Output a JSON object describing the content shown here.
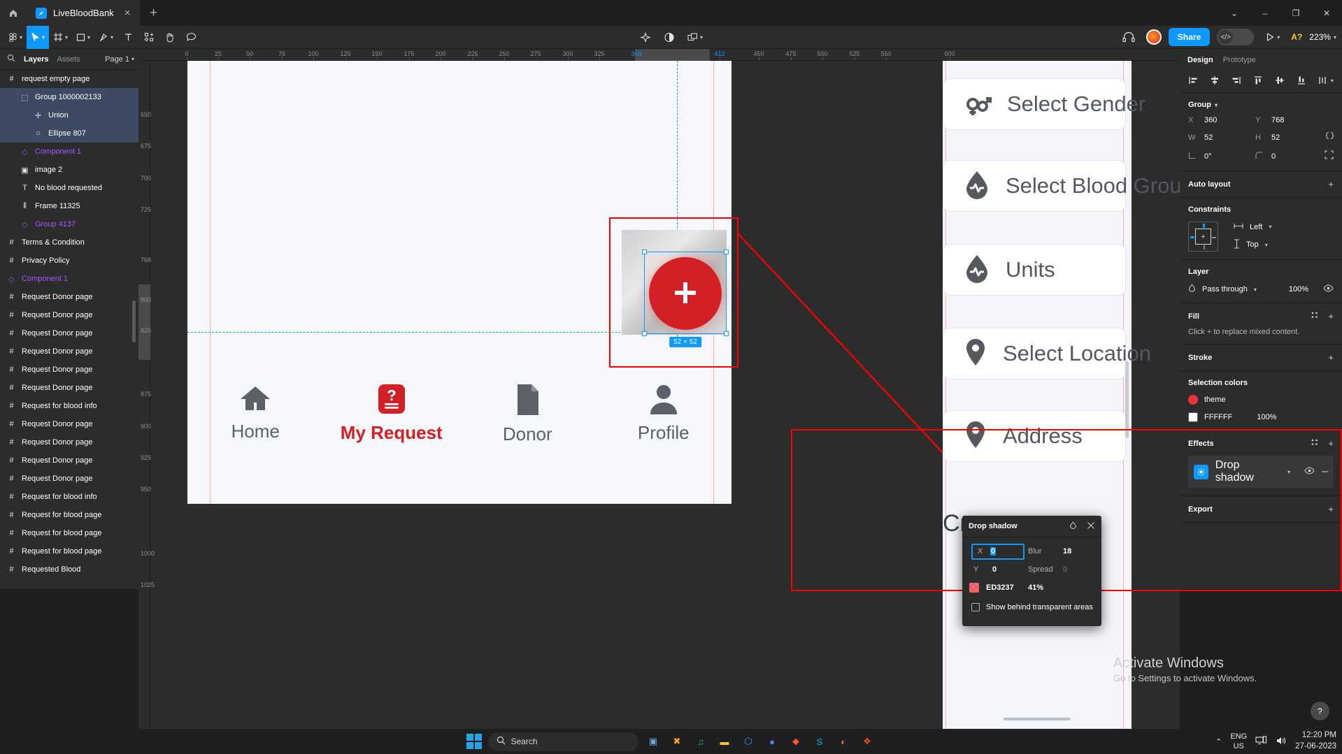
{
  "titlebar": {
    "home_icon": "home-icon",
    "tab": {
      "title": "LiveBloodBank",
      "close": "×",
      "icon": "figma-file-icon"
    },
    "new_tab": "+",
    "window": {
      "minimize": "–",
      "maximize": "❐",
      "close": "✕",
      "chevron": "⌄"
    }
  },
  "toolbar": {
    "menu_icon": "figma-logo-icon",
    "move_icon": "cursor-move-icon",
    "frame_icon": "frame-icon",
    "shape_icon": "rectangle-icon",
    "pen_icon": "pen-icon",
    "text_icon": "text-tool-icon",
    "component_icon": "component-icon",
    "hand_icon": "hand-tool-icon",
    "comment_icon": "comment-icon",
    "actions_icon": "actions-sparkle-icon",
    "contrast_icon": "contrast-icon",
    "boolean_icon": "boolean-union-icon",
    "headphones_icon": "headphones-icon",
    "avatar": "user-avatar",
    "share_label": "Share",
    "devmode_icon": "code-brackets-icon",
    "present_icon": "play-present-icon",
    "assistant_label": "A?",
    "zoom_label": "223%"
  },
  "layers_panel": {
    "search_icon": "search-icon",
    "tabs": [
      {
        "label": "Layers",
        "active": true
      },
      {
        "label": "Assets",
        "active": false
      }
    ],
    "page_selector": "Page 1",
    "items": [
      {
        "label": "request empty page",
        "icon": "frame-icon",
        "indent": 0,
        "selected": false,
        "component": false
      },
      {
        "label": "Group 1000002133",
        "icon": "group-icon",
        "indent": 1,
        "selected": true,
        "component": false
      },
      {
        "label": "Union",
        "icon": "union-icon",
        "indent": 2,
        "selected": true,
        "component": false
      },
      {
        "label": "Ellipse 807",
        "icon": "ellipse-icon",
        "indent": 2,
        "selected": true,
        "component": false
      },
      {
        "label": "Component 1",
        "icon": "component-icon",
        "indent": 1,
        "selected": false,
        "component": true
      },
      {
        "label": "image 2",
        "icon": "image-icon",
        "indent": 1,
        "selected": false,
        "component": false
      },
      {
        "label": "No blood requested",
        "icon": "text-icon",
        "indent": 1,
        "selected": false,
        "component": false
      },
      {
        "label": "Frame 11325",
        "icon": "autolayout-icon",
        "indent": 1,
        "selected": false,
        "component": false
      },
      {
        "label": "Group 4137",
        "icon": "component-icon",
        "indent": 1,
        "selected": false,
        "component": true
      },
      {
        "label": "Terms & Condition",
        "icon": "frame-icon",
        "indent": 0,
        "selected": false,
        "component": false
      },
      {
        "label": "Privacy Policy",
        "icon": "frame-icon",
        "indent": 0,
        "selected": false,
        "component": false
      },
      {
        "label": "Component 1",
        "icon": "component-icon",
        "indent": 0,
        "selected": false,
        "component": true
      },
      {
        "label": "Request Donor page",
        "icon": "frame-icon",
        "indent": 0,
        "selected": false,
        "component": false
      },
      {
        "label": "Request Donor page",
        "icon": "frame-icon",
        "indent": 0,
        "selected": false,
        "component": false
      },
      {
        "label": "Request Donor page",
        "icon": "frame-icon",
        "indent": 0,
        "selected": false,
        "component": false
      },
      {
        "label": "Request Donor page",
        "icon": "frame-icon",
        "indent": 0,
        "selected": false,
        "component": false
      },
      {
        "label": "Request Donor page",
        "icon": "frame-icon",
        "indent": 0,
        "selected": false,
        "component": false
      },
      {
        "label": "Request Donor page",
        "icon": "frame-icon",
        "indent": 0,
        "selected": false,
        "component": false
      },
      {
        "label": "Request for blood info",
        "icon": "frame-icon",
        "indent": 0,
        "selected": false,
        "component": false
      },
      {
        "label": "Request Donor page",
        "icon": "frame-icon",
        "indent": 0,
        "selected": false,
        "component": false
      },
      {
        "label": "Request Donor page",
        "icon": "frame-icon",
        "indent": 0,
        "selected": false,
        "component": false
      },
      {
        "label": "Request Donor page",
        "icon": "frame-icon",
        "indent": 0,
        "selected": false,
        "component": false
      },
      {
        "label": "Request Donor page",
        "icon": "frame-icon",
        "indent": 0,
        "selected": false,
        "component": false
      },
      {
        "label": "Request for blood info",
        "icon": "frame-icon",
        "indent": 0,
        "selected": false,
        "component": false
      },
      {
        "label": "Request for blood page",
        "icon": "frame-icon",
        "indent": 0,
        "selected": false,
        "component": false
      },
      {
        "label": "Request for blood page",
        "icon": "frame-icon",
        "indent": 0,
        "selected": false,
        "component": false
      },
      {
        "label": "Request for blood page",
        "icon": "frame-icon",
        "indent": 0,
        "selected": false,
        "component": false
      },
      {
        "label": "Requested Blood",
        "icon": "frame-icon",
        "indent": 0,
        "selected": false,
        "component": false
      }
    ]
  },
  "canvas": {
    "ruler_h_ticks": [
      "0",
      "25",
      "50",
      "75",
      "100",
      "125",
      "150",
      "175",
      "200",
      "225",
      "250",
      "275",
      "300",
      "325",
      "360",
      "412",
      "450",
      "475",
      "500",
      "525",
      "550",
      "600"
    ],
    "ruler_h_selected": [
      "360",
      "412"
    ],
    "ruler_v_ticks": [
      "650",
      "675",
      "700",
      "725",
      "768",
      "800",
      "825",
      "875",
      "900",
      "925",
      "950",
      "1000",
      "1025"
    ],
    "selection_size_chip": "52 × 52",
    "navbar": [
      {
        "label": "Home",
        "icon": "home-icon",
        "active": false
      },
      {
        "label": "My Request",
        "icon": "request-doc-icon",
        "active": true
      },
      {
        "label": "Donor",
        "icon": "document-icon",
        "active": false
      },
      {
        "label": "Profile",
        "icon": "profile-icon",
        "active": false
      }
    ],
    "fab_icon": "plus-icon",
    "preview_rows": [
      {
        "label": "Select Gender",
        "icon": "gender-icon"
      },
      {
        "label": "Select Blood Group",
        "icon": "blood-drop-icon"
      },
      {
        "label": "Units",
        "icon": "blood-drop-icon"
      },
      {
        "label": "Select Location",
        "icon": "location-pin-icon"
      },
      {
        "label": "Address",
        "icon": "location-pin-icon"
      }
    ],
    "preview_heading": "Cr"
  },
  "drop_shadow_popup": {
    "title": "Drop shadow",
    "style_icon": "style-icon",
    "close_icon": "close-icon",
    "x_label": "X",
    "x_value": "0",
    "y_label": "Y",
    "y_value": "0",
    "blur_label": "Blur",
    "blur_value": "18",
    "spread_label": "Spread",
    "spread_value": "0",
    "color_hex": "ED3237",
    "color_opacity": "41%",
    "show_behind_label": "Show behind transparent areas",
    "show_behind_checked": false
  },
  "design_panel": {
    "tabs": [
      {
        "label": "Design",
        "active": true
      },
      {
        "label": "Prototype",
        "active": false
      }
    ],
    "align_icons": [
      "align-left-icon",
      "align-horizontal-center-icon",
      "align-right-icon",
      "align-top-icon",
      "align-vertical-center-icon",
      "align-bottom-icon",
      "distribute-icon"
    ],
    "node_type": "Group",
    "x_label": "X",
    "x_value": "360",
    "y_label": "Y",
    "y_value": "768",
    "w_label": "W",
    "w_value": "52",
    "h_label": "H",
    "h_value": "52",
    "rotation_value": "0°",
    "corner_value": "0",
    "auto_layout": {
      "title": "Auto layout",
      "add": "+"
    },
    "constraints": {
      "title": "Constraints",
      "horizontal": "Left",
      "vertical": "Top"
    },
    "layer": {
      "title": "Layer",
      "blend_mode": "Pass through",
      "opacity": "100%",
      "visibility_icon": "eye-icon"
    },
    "fill": {
      "title": "Fill",
      "hint": "Click + to replace mixed content.",
      "add": "+",
      "style_icon": "styles-icon"
    },
    "stroke": {
      "title": "Stroke",
      "add": "+"
    },
    "selection_colors": {
      "title": "Selection colors",
      "items": [
        {
          "name": "theme",
          "swatch": "#ED3237",
          "opacity": ""
        },
        {
          "name": "FFFFFF",
          "swatch": "#FFFFFF",
          "opacity": "100%"
        }
      ]
    },
    "effects": {
      "title": "Effects",
      "add": "+",
      "style_icon": "styles-icon",
      "item": {
        "label": "Drop shadow",
        "visibility_icon": "eye-icon",
        "remove": "–",
        "icon": "effect-icon"
      }
    },
    "export": {
      "title": "Export",
      "add": "+"
    },
    "help_icon": "help-icon"
  },
  "watermark": {
    "line1": "Activate Windows",
    "line2": "Go to Settings to activate Windows."
  },
  "taskbar": {
    "start_icon": "windows-start-icon",
    "search_placeholder": "Search",
    "search_icon": "search-icon",
    "apps": [
      {
        "name": "task-view-icon",
        "glyph": "▣",
        "color": "#6aa9e0"
      },
      {
        "name": "xampp-icon",
        "glyph": "✖",
        "color": "#f5a623"
      },
      {
        "name": "spotify-icon",
        "glyph": "♫",
        "color": "#1db954"
      },
      {
        "name": "file-explorer-icon",
        "glyph": "▬",
        "color": "#ffc83d"
      },
      {
        "name": "vscode-icon",
        "glyph": "⬡",
        "color": "#3aa0e8"
      },
      {
        "name": "chrome-icon",
        "glyph": "●",
        "color": "#4285f4"
      },
      {
        "name": "brave-icon",
        "glyph": "◆",
        "color": "#fb542b"
      },
      {
        "name": "skype-icon",
        "glyph": "S",
        "color": "#00aff0"
      },
      {
        "name": "postman-icon",
        "glyph": "◐",
        "color": "#ff6c37"
      },
      {
        "name": "figma-app-icon",
        "glyph": "❖",
        "color": "#f24e1e"
      }
    ],
    "tray": {
      "chevron": "⌃",
      "language": {
        "line1": "ENG",
        "line2": "US"
      },
      "network_icon": "network-icon",
      "volume_icon": "volume-icon",
      "time": "12:20 PM",
      "date": "27-06-2023"
    }
  }
}
